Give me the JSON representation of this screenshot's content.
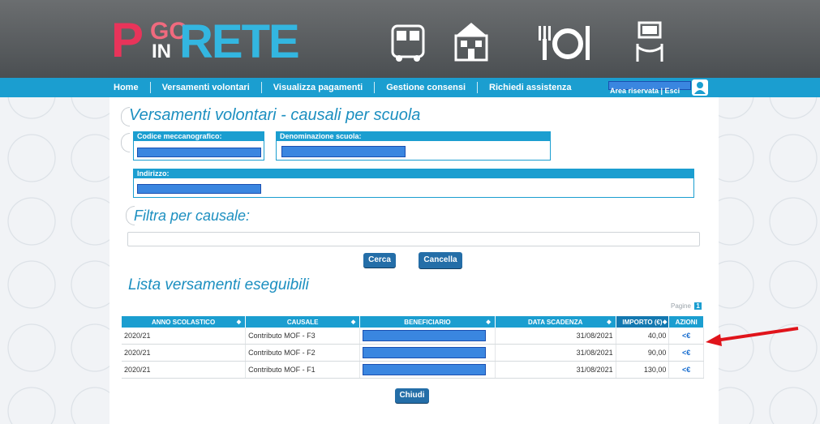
{
  "logo": {
    "p": "P",
    "go": "GO",
    "in": "IN",
    "rete": "RETE"
  },
  "nav": {
    "items": [
      "Home",
      "Versamenti volontari",
      "Visualizza pagamenti",
      "Gestione consensi",
      "Richiedi assistenza"
    ],
    "area_link": "Area riservata | Esci"
  },
  "page": {
    "title": "Versamenti volontari - causali per scuola",
    "fields": {
      "codice_label": "Codice meccanografico:",
      "denominazione_label": "Denominazione scuola:",
      "indirizzo_label": "Indirizzo:"
    },
    "filter_title": "Filtra per causale:",
    "search_button": "Cerca",
    "cancel_button": "Cancella",
    "list_title": "Lista versamenti eseguibili",
    "pager_label": "Pagine",
    "pager_current": "1",
    "close_button": "Chiudi"
  },
  "table": {
    "headers": [
      "ANNO SCOLASTICO",
      "CAUSALE",
      "BENEFICIARIO",
      "DATA SCADENZA",
      "IMPORTO (€)",
      "AZIONI"
    ],
    "rows": [
      {
        "anno": "2020/21",
        "causale": "Contributo MOF - F3",
        "scadenza": "31/08/2021",
        "importo": "40,00",
        "azione": "<€"
      },
      {
        "anno": "2020/21",
        "causale": "Contributo MOF - F2",
        "scadenza": "31/08/2021",
        "importo": "90,00",
        "azione": "<€"
      },
      {
        "anno": "2020/21",
        "causale": "Contributo MOF - F1",
        "scadenza": "31/08/2021",
        "importo": "130,00",
        "azione": "<€"
      }
    ]
  },
  "colors": {
    "primary": "#1b9ed0",
    "button": "#246ea8",
    "title": "#1c8fc0",
    "redaction": "#3a86e0",
    "arrow": "#e0141b"
  }
}
